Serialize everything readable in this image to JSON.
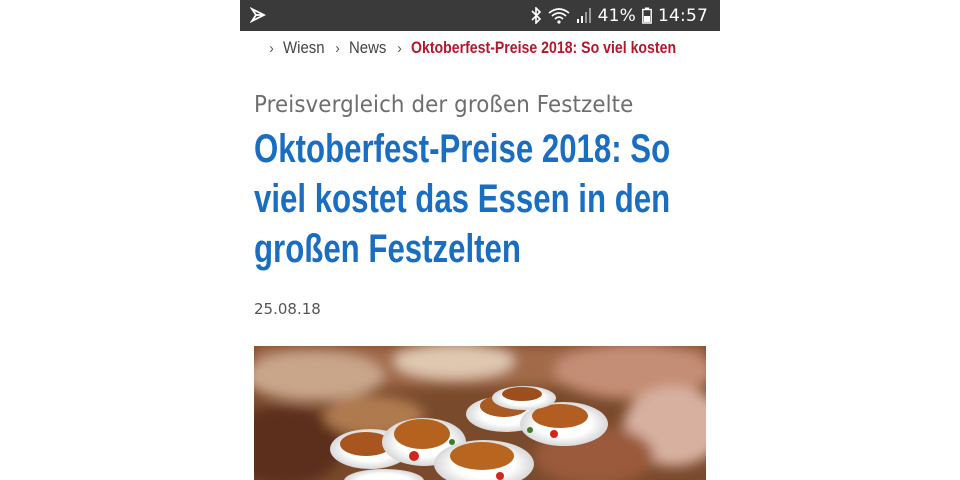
{
  "status_bar": {
    "battery_percent": "41%",
    "time": "14:57",
    "icons": [
      "app-notification-icon",
      "bluetooth-icon",
      "wifi-icon",
      "signal-icon",
      "battery-icon"
    ]
  },
  "breadcrumb": {
    "home_icon": "home-icon",
    "items": [
      "Wiesn",
      "News"
    ],
    "current": "Oktoberfest-Preise 2018: So viel kosten",
    "separator": "›"
  },
  "article": {
    "kicker": "Preisvergleich der großen Festzelte",
    "headline": "Oktoberfest-Preise 2018: So viel kostet das Essen in den großen Festzelten",
    "date": "25.08.18",
    "colors": {
      "headline": "#1a6ec2",
      "breadcrumb_current": "#b5172b"
    }
  }
}
